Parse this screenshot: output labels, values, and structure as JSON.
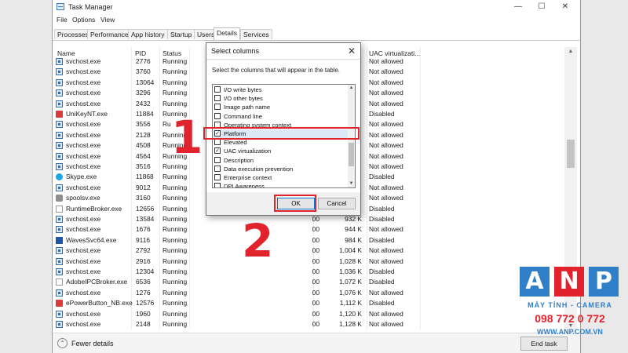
{
  "window": {
    "title": "Task Manager",
    "minimize": "—",
    "maximize": "☐",
    "close": "✕"
  },
  "menu": [
    "File",
    "Options",
    "View"
  ],
  "tabs": [
    {
      "label": "Processes",
      "active": false
    },
    {
      "label": "Performance",
      "active": false
    },
    {
      "label": "App history",
      "active": false
    },
    {
      "label": "Startup",
      "active": false
    },
    {
      "label": "Users",
      "active": false
    },
    {
      "label": "Details",
      "active": true
    },
    {
      "label": "Services",
      "active": false
    }
  ],
  "columns": {
    "name": "Name",
    "pid": "PID",
    "status": "Status",
    "uac": "UAC virtualizati..."
  },
  "processes": [
    {
      "name": "svchost.exe",
      "pid": "2776",
      "status": "Running",
      "cpu": "",
      "mem": "",
      "uac": "Not allowed",
      "icon": "blue"
    },
    {
      "name": "svchost.exe",
      "pid": "3760",
      "status": "Running",
      "cpu": "",
      "mem": "",
      "uac": "Not allowed",
      "icon": "blue"
    },
    {
      "name": "svchost.exe",
      "pid": "13064",
      "status": "Running",
      "cpu": "",
      "mem": "",
      "uac": "Not allowed",
      "icon": "blue"
    },
    {
      "name": "svchost.exe",
      "pid": "3296",
      "status": "Running",
      "cpu": "",
      "mem": "",
      "uac": "Not allowed",
      "icon": "blue"
    },
    {
      "name": "svchost.exe",
      "pid": "2432",
      "status": "Running",
      "cpu": "",
      "mem": "",
      "uac": "Not allowed",
      "icon": "blue"
    },
    {
      "name": "UniKeyNT.exe",
      "pid": "11884",
      "status": "Running",
      "cpu": "",
      "mem": "",
      "uac": "Disabled",
      "icon": "red"
    },
    {
      "name": "svchost.exe",
      "pid": "3556",
      "status": "Ru",
      "cpu": "",
      "mem": "",
      "uac": "Not allowed",
      "icon": "blue"
    },
    {
      "name": "svchost.exe",
      "pid": "2128",
      "status": "Running",
      "cpu": "",
      "mem": "",
      "uac": "Not allowed",
      "icon": "blue"
    },
    {
      "name": "svchost.exe",
      "pid": "4508",
      "status": "Running",
      "cpu": "",
      "mem": "",
      "uac": "Not allowed",
      "icon": "blue"
    },
    {
      "name": "svchost.exe",
      "pid": "4564",
      "status": "Running",
      "cpu": "",
      "mem": "",
      "uac": "Not allowed",
      "icon": "blue"
    },
    {
      "name": "svchost.exe",
      "pid": "3516",
      "status": "Running",
      "cpu": "",
      "mem": "",
      "uac": "Not allowed",
      "icon": "blue"
    },
    {
      "name": "Skype.exe",
      "pid": "11868",
      "status": "Running",
      "cpu": "",
      "mem": "",
      "uac": "Disabled",
      "icon": "skype"
    },
    {
      "name": "svchost.exe",
      "pid": "9012",
      "status": "Running",
      "cpu": "",
      "mem": "",
      "uac": "Not allowed",
      "icon": "blue"
    },
    {
      "name": "spoolsv.exe",
      "pid": "3160",
      "status": "Running",
      "cpu": "",
      "mem": "",
      "uac": "Not allowed",
      "icon": "gray"
    },
    {
      "name": "RuntimeBroker.exe",
      "pid": "12656",
      "status": "Running",
      "cpu": "",
      "mem": "",
      "uac": "Disabled",
      "icon": "white"
    },
    {
      "name": "svchost.exe",
      "pid": "13584",
      "status": "Running",
      "cpu": "00",
      "mem": "932 K",
      "uac": "Disabled",
      "icon": "blue"
    },
    {
      "name": "svchost.exe",
      "pid": "1676",
      "status": "Running",
      "cpu": "00",
      "mem": "944 K",
      "uac": "Not allowed",
      "icon": "blue"
    },
    {
      "name": "WavesSvc64.exe",
      "pid": "9116",
      "status": "Running",
      "cpu": "00",
      "mem": "984 K",
      "uac": "Disabled",
      "icon": "wave"
    },
    {
      "name": "svchost.exe",
      "pid": "2792",
      "status": "Running",
      "cpu": "00",
      "mem": "1,004 K",
      "uac": "Not allowed",
      "icon": "blue"
    },
    {
      "name": "svchost.exe",
      "pid": "2916",
      "status": "Running",
      "cpu": "00",
      "mem": "1,028 K",
      "uac": "Not allowed",
      "icon": "blue"
    },
    {
      "name": "svchost.exe",
      "pid": "12304",
      "status": "Running",
      "cpu": "00",
      "mem": "1,036 K",
      "uac": "Disabled",
      "icon": "blue"
    },
    {
      "name": "AdobeIPCBroker.exe",
      "pid": "6536",
      "status": "Running",
      "cpu": "00",
      "mem": "1,072 K",
      "uac": "Disabled",
      "icon": "white"
    },
    {
      "name": "svchost.exe",
      "pid": "1276",
      "status": "Running",
      "cpu": "00",
      "mem": "1,076 K",
      "uac": "Not allowed",
      "icon": "blue"
    },
    {
      "name": "ePowerButton_NB.exe",
      "pid": "12576",
      "status": "Running",
      "cpu": "00",
      "mem": "1,112 K",
      "uac": "Disabled",
      "icon": "red"
    },
    {
      "name": "svchost.exe",
      "pid": "1960",
      "status": "Running",
      "cpu": "00",
      "mem": "1,120 K",
      "uac": "Not allowed",
      "icon": "blue"
    },
    {
      "name": "svchost.exe",
      "pid": "2148",
      "status": "Running",
      "cpu": "00",
      "mem": "1,128 K",
      "uac": "Not allowed",
      "icon": "blue"
    }
  ],
  "footer": {
    "fewer_details": "Fewer details",
    "end_task": "End task"
  },
  "dialog": {
    "title": "Select columns",
    "close": "✕",
    "instruction": "Select the columns that will appear in the table.",
    "options": [
      {
        "label": "I/O write bytes",
        "checked": false
      },
      {
        "label": "I/O other bytes",
        "checked": false
      },
      {
        "label": "Image path name",
        "checked": false
      },
      {
        "label": "Command line",
        "checked": false
      },
      {
        "label": "Operating system context",
        "checked": false
      },
      {
        "label": "Platform",
        "checked": true
      },
      {
        "label": "Elevated",
        "checked": false
      },
      {
        "label": "UAC virtualization",
        "checked": true
      },
      {
        "label": "Description",
        "checked": false
      },
      {
        "label": "Data execution prevention",
        "checked": false
      },
      {
        "label": "Enterprise context",
        "checked": false
      },
      {
        "label": "DPI Awareness",
        "checked": false
      }
    ],
    "ok": "OK",
    "cancel": "Cancel"
  },
  "annotations": {
    "step1": "1",
    "step2": "2",
    "highlight_color": "#e0232c"
  },
  "watermark": {
    "letters": [
      "A",
      "N",
      "P"
    ],
    "colors": [
      "#2f7fc9",
      "#e0232c",
      "#2f7fc9"
    ],
    "line1": "MÁY TÍNH - CAMERA",
    "line2": "098 772 0 772",
    "line3": "WWW.ANP.COM.VN"
  }
}
